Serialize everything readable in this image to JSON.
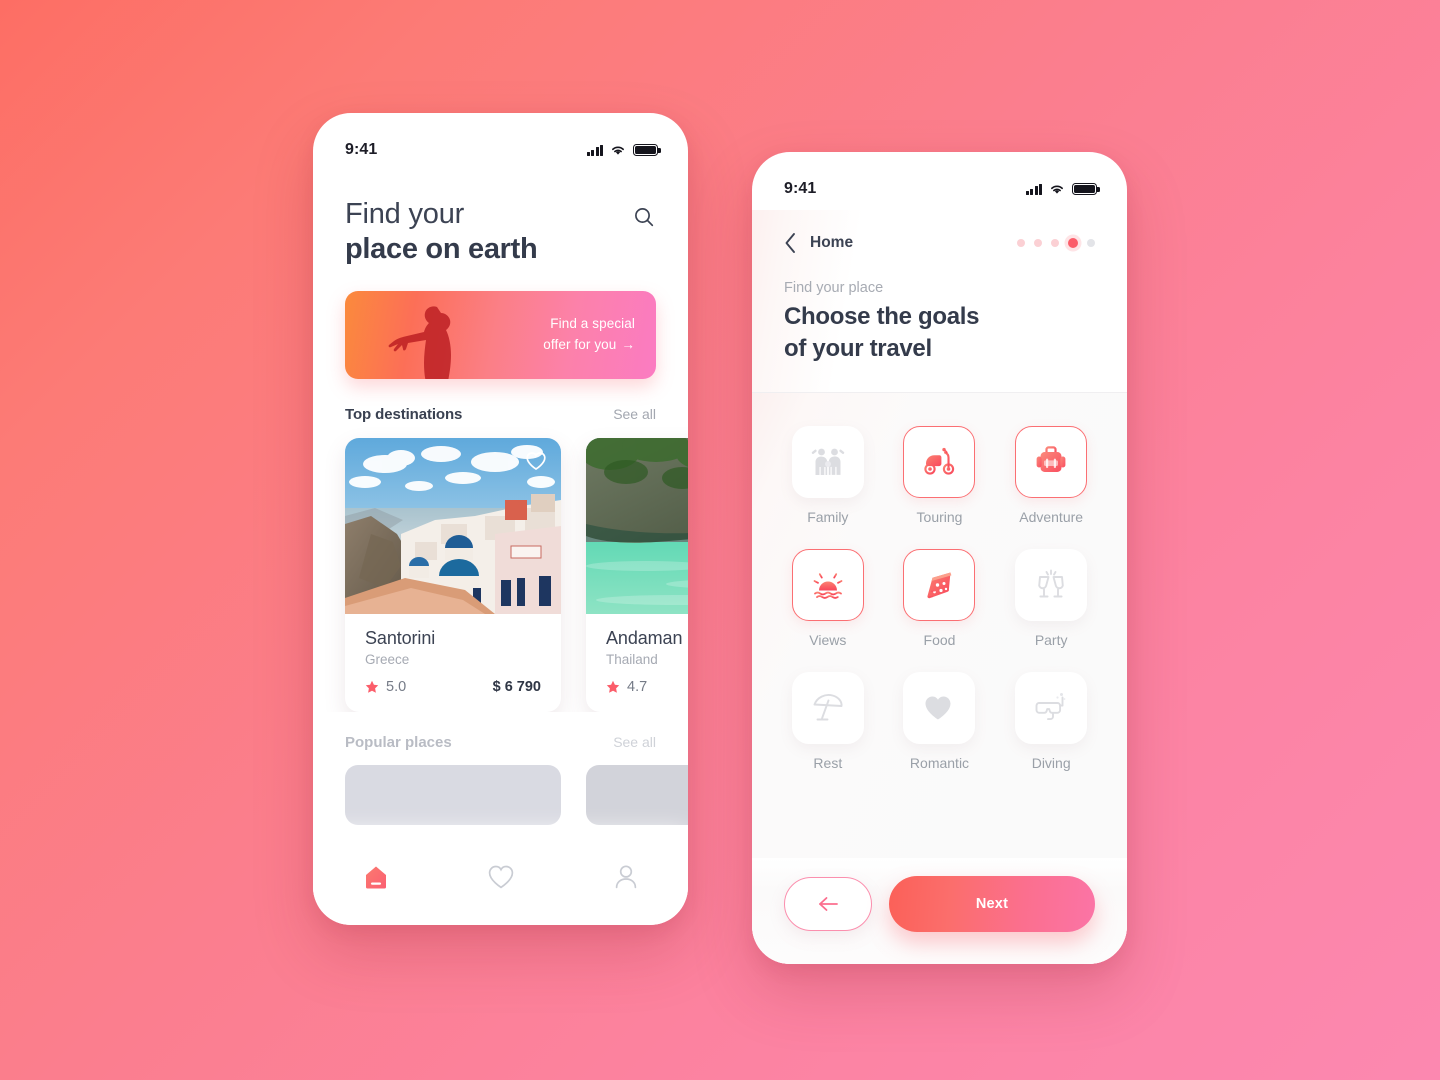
{
  "background": {
    "from": "#FD6E64",
    "to": "#FC88B0"
  },
  "accent": {
    "coral": "#FB5D6A",
    "pink": "#FB74A6",
    "muted_gray": "#9AA0A8"
  },
  "phone_home": {
    "status_bar": {
      "time": "9:41",
      "signal_icon": "cellular-signal-icon",
      "wifi_icon": "wifi-icon",
      "battery_icon": "battery-full-icon"
    },
    "header": {
      "title_line1": "Find your",
      "title_line2": "place on earth",
      "search_icon": "search-icon"
    },
    "promo": {
      "line1": "Find a special",
      "line2": "offer for you",
      "arrow": "→"
    },
    "top_destinations": {
      "section_title": "Top destinations",
      "see_all": "See all",
      "cards": [
        {
          "name": "Santorini",
          "country": "Greece",
          "rating": "5.0",
          "price": "$ 6 790",
          "favorite_icon": "heart-outline-icon"
        },
        {
          "name": "Andaman",
          "country": "Thailand",
          "rating": "4.7",
          "price": ""
        }
      ]
    },
    "popular_places": {
      "section_title": "Popular places",
      "see_all": "See all"
    },
    "tabbar": [
      {
        "name": "home",
        "icon": "home-icon",
        "active": true
      },
      {
        "name": "favorites",
        "icon": "heart-outline-icon",
        "active": false
      },
      {
        "name": "profile",
        "icon": "user-outline-icon",
        "active": false
      }
    ]
  },
  "phone_goals": {
    "status_bar": {
      "time": "9:41",
      "signal_icon": "cellular-signal-icon",
      "wifi_icon": "wifi-icon",
      "battery_icon": "battery-full-icon"
    },
    "header": {
      "back_icon": "chevron-left-icon",
      "back_label": "Home",
      "kicker": "Find your place",
      "title_line1": "Choose the goals",
      "title_line2": "of your travel"
    },
    "pagination": {
      "total": 5,
      "active_index": 3
    },
    "goals": [
      {
        "label": "Family",
        "icon": "family-icon",
        "selected": false
      },
      {
        "label": "Touring",
        "icon": "scooter-icon",
        "selected": true
      },
      {
        "label": "Adventure",
        "icon": "backpack-icon",
        "selected": true
      },
      {
        "label": "Views",
        "icon": "sunset-icon",
        "selected": true
      },
      {
        "label": "Food",
        "icon": "pizza-icon",
        "selected": true
      },
      {
        "label": "Party",
        "icon": "cheers-icon",
        "selected": false
      },
      {
        "label": "Rest",
        "icon": "umbrella-icon",
        "selected": false
      },
      {
        "label": "Romantic",
        "icon": "heart-filled-icon",
        "selected": false
      },
      {
        "label": "Diving",
        "icon": "snorkel-mask-icon",
        "selected": false
      }
    ],
    "footer": {
      "back_icon": "arrow-left-icon",
      "next_label": "Next"
    }
  }
}
